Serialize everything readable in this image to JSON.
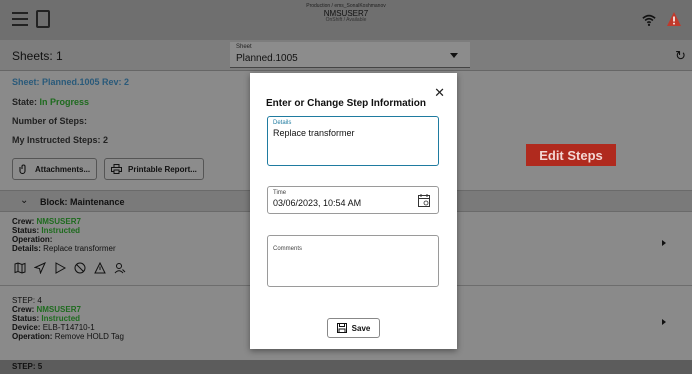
{
  "topbar": {
    "line1": "Production / ems_SonalKoshmanov",
    "user": "NMSUSER7",
    "status": "OnShift / Available"
  },
  "sheetbar": {
    "sheets_label": "Sheets: 1",
    "select_label": "Sheet",
    "select_value": "Planned.1005"
  },
  "info": {
    "sheet_link": "Sheet: Planned.1005 Rev: 2",
    "state_label": "State:",
    "state_value": "In Progress",
    "num_steps": "Number of Steps:",
    "my_steps": "My Instructed Steps: 2",
    "attachments_btn": "Attachments...",
    "printable_btn": "Printable Report..."
  },
  "edit_steps": "Edit Steps",
  "block": {
    "label": "Block: Maintenance"
  },
  "step1": {
    "crew_label": "Crew:",
    "crew_value": "NMSUSER7",
    "status_label": "Status:",
    "status_value": "Instructed",
    "operation_label": "Operation:",
    "details_label": "Details:",
    "details_value": "Replace transformer"
  },
  "step2": {
    "step_label": "STEP: 4",
    "crew_label": "Crew:",
    "crew_value": "NMSUSER7",
    "status_label": "Status:",
    "status_value": "Instructed",
    "device_label": "Device:",
    "device_value": "ELB-T14710-1",
    "operation_label": "Operation:",
    "operation_value": "Remove HOLD Tag"
  },
  "next_step": "STEP: 5",
  "modal": {
    "title": "Enter or Change Step Information",
    "details_label": "Details",
    "details_value": "Replace transformer",
    "time_label": "Time",
    "time_value": "03/06/2023, 10:54 AM",
    "comments_label": "Comments",
    "save_label": "Save"
  },
  "colors": {
    "accent": "#1f7ba0",
    "edit_steps_bg": "#b02a1e",
    "status_green": "#1e6b1e",
    "warning": "#c0392b"
  },
  "icons": [
    "menu-icon",
    "document-icon",
    "wifi-icon",
    "warning-icon",
    "refresh-icon",
    "paperclip-icon",
    "printer-icon",
    "chevron-down-icon",
    "map-icon",
    "navigate-icon",
    "play-icon",
    "block-icon",
    "alert-icon",
    "person-search-icon",
    "calendar-icon",
    "close-icon",
    "save-icon",
    "caret-right-icon"
  ]
}
